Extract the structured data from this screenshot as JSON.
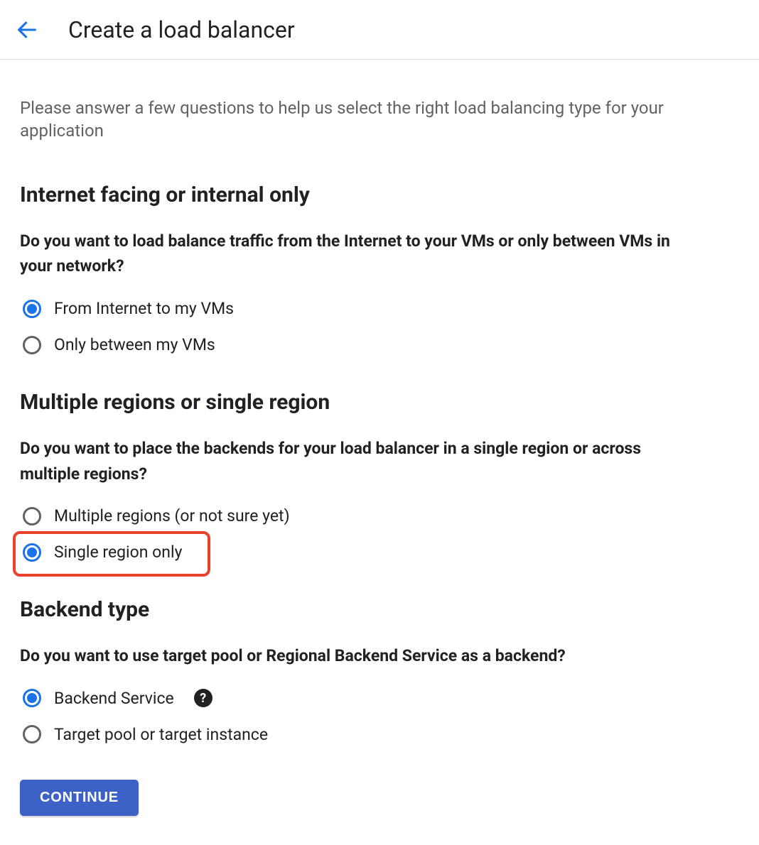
{
  "header": {
    "title": "Create a load balancer"
  },
  "intro": "Please answer a few questions to help us select the right load balancing type for your application",
  "sections": {
    "facing": {
      "heading": "Internet facing or internal only",
      "question": "Do you want to load balance traffic from the Internet to your VMs or only between VMs in your network?",
      "options": [
        {
          "label": "From Internet to my VMs",
          "selected": true
        },
        {
          "label": "Only between my VMs",
          "selected": false
        }
      ]
    },
    "region": {
      "heading": "Multiple regions or single region",
      "question": "Do you want to place the backends for your load balancer in a single region or across multiple regions?",
      "options": [
        {
          "label": "Multiple regions (or not sure yet)",
          "selected": false
        },
        {
          "label": "Single region only",
          "selected": true,
          "highlighted": true
        }
      ]
    },
    "backend": {
      "heading": "Backend type",
      "question": "Do you want to use target pool or Regional Backend Service as a backend?",
      "options": [
        {
          "label": "Backend Service",
          "selected": true,
          "help": true
        },
        {
          "label": "Target pool or target instance",
          "selected": false
        }
      ]
    }
  },
  "continue_label": "CONTINUE"
}
